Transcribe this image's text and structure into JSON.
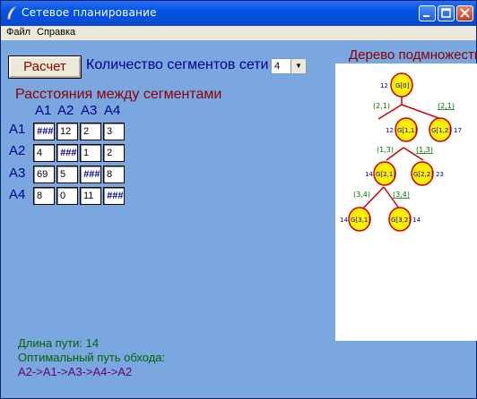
{
  "window": {
    "title": "Сетевое планирование"
  },
  "menu": {
    "file": "Файл",
    "help": "Справка"
  },
  "controls": {
    "calc_label": "Расчет",
    "segments_label": "Количество сегментов сети",
    "segments_value": "4"
  },
  "distances": {
    "title": "Расстояния между сегментами",
    "cols": [
      "A1",
      "A2",
      "A3",
      "A4"
    ],
    "rows": [
      {
        "label": "A1",
        "cells": [
          "###",
          "12",
          "2",
          "3"
        ]
      },
      {
        "label": "A2",
        "cells": [
          "4",
          "###",
          "1",
          "2"
        ]
      },
      {
        "label": "A3",
        "cells": [
          "69",
          "5",
          "###",
          "8"
        ]
      },
      {
        "label": "A4",
        "cells": [
          "8",
          "0",
          "11",
          "###"
        ]
      }
    ]
  },
  "tree": {
    "title": "Дерево подмножеств",
    "nodes": [
      {
        "label": "G[0]",
        "cost": "12"
      },
      {
        "label": "G[1,1]",
        "cost": "12"
      },
      {
        "label": "G[1,2]",
        "cost": "17"
      },
      {
        "label": "G[2,1]",
        "cost": "14"
      },
      {
        "label": "G[2,2]",
        "cost": "23"
      },
      {
        "label": "G[3,1]",
        "cost": "14"
      },
      {
        "label": "G[3,2]",
        "cost": "14"
      }
    ],
    "edges": [
      {
        "label": "(2,1)",
        "negated": false
      },
      {
        "label": "(2,1)",
        "negated": true
      },
      {
        "label": "(1,3)",
        "negated": false
      },
      {
        "label": "(1,3)",
        "negated": true
      },
      {
        "label": "(3,4)",
        "negated": false
      },
      {
        "label": "(3,4)",
        "negated": true
      }
    ],
    "colors": {
      "node_fill": "#ffee00",
      "node_stroke": "#cc0000",
      "edge": "#cc0000",
      "edge_label": "#007000",
      "cost": "#000099"
    }
  },
  "result": {
    "length_label": "Длина пути:",
    "length_value": "14",
    "optimal_label": "Оптимальный путь обхода:",
    "path": "A2->A1->A3->A4->A2"
  }
}
